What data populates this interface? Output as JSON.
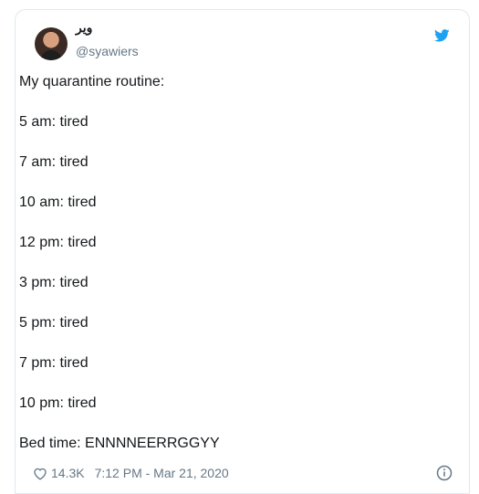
{
  "tweet": {
    "author_name": "ویر",
    "author_handle": "@syawiers",
    "lines": [
      "My quarantine routine:",
      "5 am: tired",
      "7 am: tired",
      "10 am: tired",
      "12 pm: tired",
      "3 pm: tired",
      "5 pm: tired",
      "7 pm: tired",
      "10 pm: tired",
      "Bed time: ENNNNEERRGGYY"
    ],
    "like_count": "14.3K",
    "timestamp": "7:12 PM - Mar 21, 2020"
  },
  "colors": {
    "twitter_blue": "#1da1f2",
    "muted": "#657786"
  },
  "icons": [
    "twitter-bird-icon",
    "heart-icon",
    "info-icon"
  ]
}
